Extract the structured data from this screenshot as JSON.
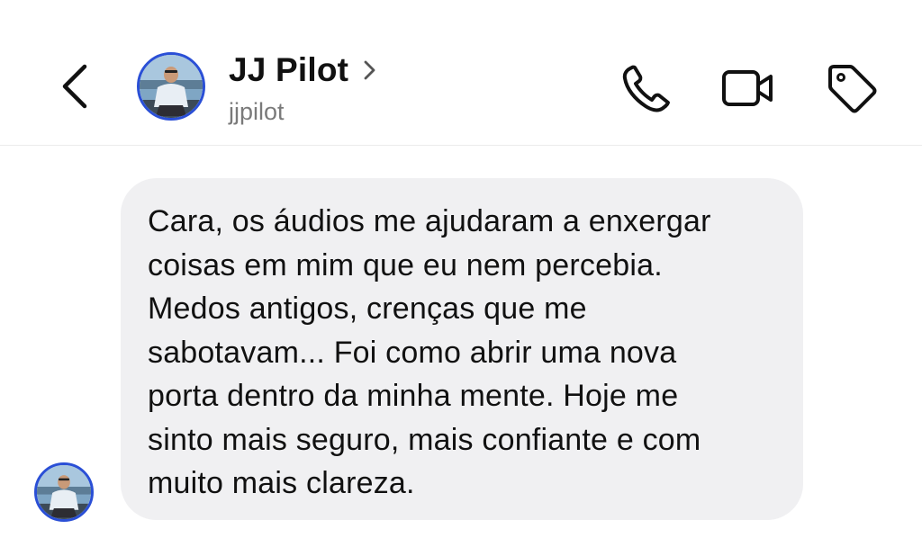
{
  "header": {
    "back_icon": "chevron-left-icon",
    "contact_name": "JJ Pilot",
    "name_chevron_icon": "chevron-right-icon",
    "username": "jjpilot",
    "actions": [
      {
        "icon": "phone-icon"
      },
      {
        "icon": "video-camera-icon"
      },
      {
        "icon": "tag-icon"
      }
    ],
    "avatar_ring_color": "#2a4fd6"
  },
  "thread": {
    "messages": [
      {
        "sender": "incoming",
        "text": "Cara, os áudios me ajudaram a enxergar\ncoisas em mim que eu nem percebia.\nMedos antigos, crenças que me\nsabotavam... Foi como abrir uma nova\nporta dentro da minha mente. Hoje me\nsinto mais seguro, mais confiante e com\nmuito mais clareza."
      }
    ],
    "bubble_color": "#f0f0f2"
  }
}
